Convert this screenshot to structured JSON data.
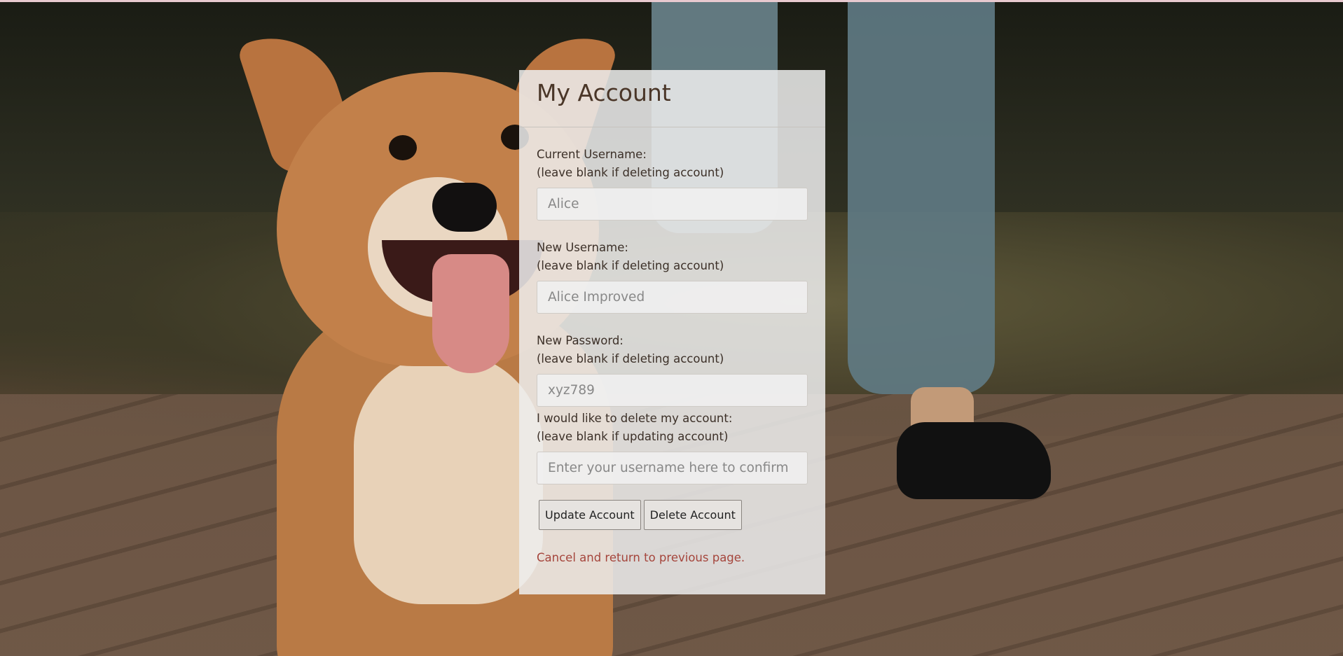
{
  "page": {
    "title": "My Account"
  },
  "form": {
    "current_username": {
      "label": "Current Username:",
      "hint": "(leave blank if deleting account)",
      "placeholder": "Alice"
    },
    "new_username": {
      "label": "New Username:",
      "hint": "(leave blank if deleting account)",
      "placeholder": "Alice Improved"
    },
    "new_password": {
      "label": "New Password:",
      "hint": "(leave blank if deleting account)",
      "placeholder": "xyz789"
    },
    "delete_confirm": {
      "label": "I would like to delete my account:",
      "hint": "(leave blank if updating account)",
      "placeholder": "Enter your username here to confirm"
    },
    "update_label": "Update Account",
    "delete_label": "Delete Account",
    "cancel_text": "Cancel and return to previous page."
  },
  "colors": {
    "title": "#4a3628",
    "link": "#a5453c",
    "panel": "#eeeeee"
  }
}
